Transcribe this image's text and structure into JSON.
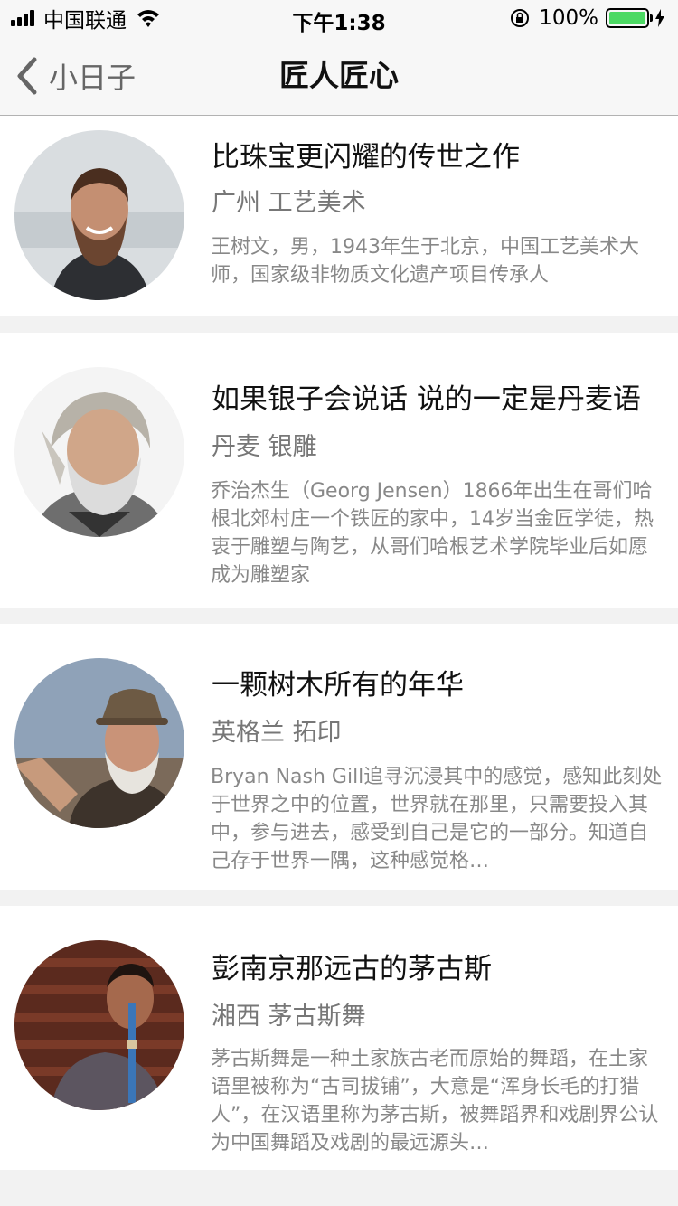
{
  "status_bar": {
    "carrier": "中国联通",
    "time": "下午1:38",
    "battery": "100%",
    "battery_level": 1.0,
    "battery_color": "#4cd964"
  },
  "nav": {
    "back_label": "小日子",
    "title": "匠人匠心"
  },
  "items": [
    {
      "title": "比珠宝更闪耀的传世之作",
      "location": "广州 工艺美术",
      "description": "王树文，男，1943年生于北京，中国工艺美术大师，国家级非物质文化遗产项目传承人"
    },
    {
      "title": "如果银子会说话 说的一定是丹麦语",
      "location": "丹麦 银雕",
      "description": "乔治杰生（Georg Jensen）1866年出生在哥们哈根北郊村庄一个铁匠的家中，14岁当金匠学徒，热衷于雕塑与陶艺，从哥们哈根艺术学院毕业后如愿成为雕塑家"
    },
    {
      "title": "一颗树木所有的年华",
      "location": "英格兰 拓印",
      "description": "Bryan Nash Gill追寻沉浸其中的感觉，感知此刻处于世界之中的位置，世界就在那里，只需要投入其中，参与进去，感受到自己是它的一部分。知道自己存于世界一隅，这种感觉格…"
    },
    {
      "title": "彭南京那远古的茅古斯",
      "location": "湘西 茅古斯舞",
      "description": "茅古斯舞是一种土家族古老而原始的舞蹈，在土家语里被称为“古司拔铺”，大意是“浑身长毛的打猎人”，在汉语里称为茅古斯，被舞蹈界和戏剧界公认为中国舞蹈及戏剧的最远源头…"
    }
  ]
}
